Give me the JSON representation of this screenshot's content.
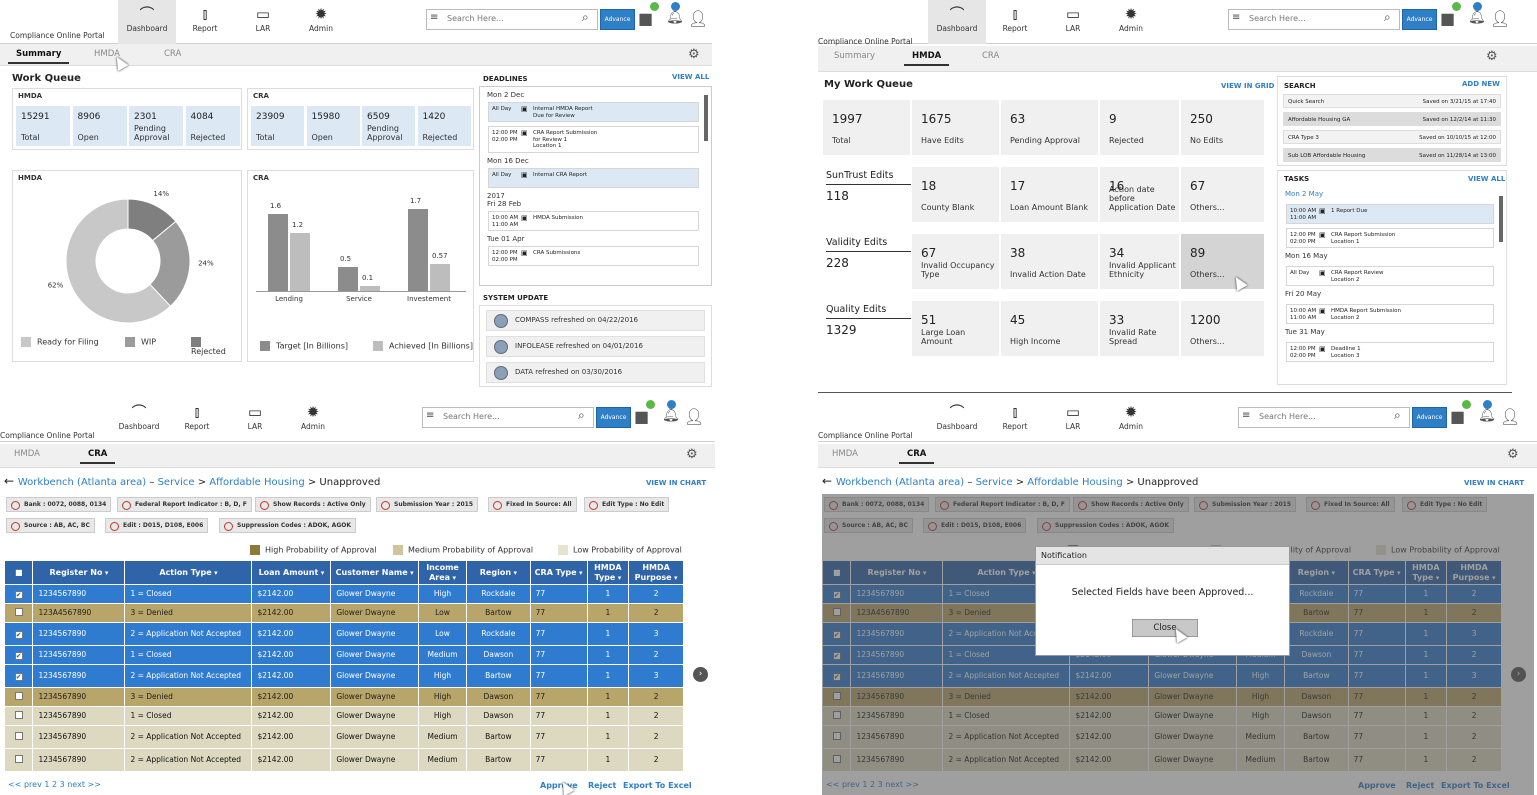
{
  "app": {
    "brand": "Compliance Online Portal",
    "nav": [
      "Dashboard",
      "Report",
      "LAR",
      "Admin"
    ],
    "search_placeholder": "Search Here...",
    "advance": "Advance"
  },
  "q1": {
    "tabs": [
      "Summary",
      "HMDA",
      "CRA"
    ],
    "work_queue": "Work Queue",
    "deadlines": "DEADLINES",
    "view_all": "VIEW ALL",
    "hmda": {
      "title": "HMDA",
      "tiles": [
        [
          "15291",
          "Total"
        ],
        [
          "8906",
          "Open"
        ],
        [
          "2301",
          "Pending Approval"
        ],
        [
          "4084",
          "Rejected"
        ]
      ]
    },
    "cra": {
      "title": "CRA",
      "tiles": [
        [
          "23909",
          "Total"
        ],
        [
          "15980",
          "Open"
        ],
        [
          "6509",
          "Pending Approval"
        ],
        [
          "1420",
          "Rejected"
        ]
      ]
    },
    "deadline_items": [
      {
        "date": "Mon 2 Dec"
      },
      {
        "time": "All Day",
        "text": "Internal HMDA Report\nDue for Review",
        "hl": true
      },
      {
        "time": "12:00 PM\n02:00 PM",
        "text": "CRA Report Submission\nfor Review 1\nLocation 1"
      },
      {
        "date": "Mon 16 Dec"
      },
      {
        "time": "All Day",
        "text": "Internal CRA Report",
        "hl": true
      },
      {
        "date": "2017\nFri 28 Feb"
      },
      {
        "time": "10:00 AM\n11:00 AM",
        "text": "HMDA Submission"
      },
      {
        "date": "Tue 01 Apr"
      },
      {
        "time": "12:00 PM\n02:00 PM",
        "text": "CRA Submissions"
      }
    ],
    "system_update": "SYSTEM UPDATE",
    "updates": [
      "COMPASS refreshed on 04/22/2016",
      "INFOLEASE refreshed on 04/01/2016",
      "DATA refreshed on 03/30/2016"
    ],
    "donut_title": "HMDA",
    "donut_legend": [
      "Ready for Filing",
      "WIP",
      "Rejected"
    ],
    "bar_title": "CRA",
    "bar_legend": [
      "Target [In Billions]",
      "Achieved [In Billions]"
    ]
  },
  "chart_data": [
    {
      "type": "pie",
      "title": "HMDA",
      "categories": [
        "Ready for Filing",
        "WIP",
        "Rejected"
      ],
      "values": [
        62,
        24,
        14
      ],
      "colors": [
        "#c8c8c8",
        "#9b9b9b",
        "#7f7f7f"
      ],
      "labels": [
        "62%",
        "24%",
        "14%"
      ]
    },
    {
      "type": "bar",
      "title": "CRA",
      "categories": [
        "Lending",
        "Service",
        "Investement"
      ],
      "series": [
        {
          "name": "Target [In Billions]",
          "values": [
            1.6,
            0.5,
            1.7
          ],
          "color": "#8c8c8c"
        },
        {
          "name": "Achieved [In Billions]",
          "values": [
            1.2,
            0.1,
            0.57
          ],
          "color": "#bdbdbd"
        }
      ],
      "ylim": [
        0,
        2
      ]
    }
  ],
  "q2": {
    "tabs": [
      "Summary",
      "HMDA",
      "CRA"
    ],
    "title": "My Work Queue",
    "view_grid": "VIEW IN GRID",
    "row1": [
      [
        "1997",
        "Total"
      ],
      [
        "1675",
        "Have Edits"
      ],
      [
        "63",
        "Pending Approval"
      ],
      [
        "9",
        "Rejected"
      ],
      [
        "250",
        "No Edits"
      ]
    ],
    "groups": [
      {
        "name": "SunTrust  Edits",
        "count": "118",
        "tiles": [
          [
            "18",
            "County Blank"
          ],
          [
            "17",
            "Loan Amount Blank"
          ],
          [
            "16",
            "Action date before Application Date"
          ],
          [
            "67",
            "Others..."
          ]
        ]
      },
      {
        "name": "Validity Edits",
        "count": "228",
        "tiles": [
          [
            "67",
            "Invalid Occupancy Type"
          ],
          [
            "38",
            "Invalid Action Date"
          ],
          [
            "34",
            "Invalid Applicant Ethnicity"
          ],
          [
            "89",
            "Others..."
          ]
        ]
      },
      {
        "name": "Quality Edits",
        "count": "1329",
        "tiles": [
          [
            "51",
            "Large Loan Amount"
          ],
          [
            "45",
            "High Income"
          ],
          [
            "33",
            "Invalid Rate Spread"
          ],
          [
            "1200",
            "Others..."
          ]
        ]
      }
    ],
    "search": "SEARCH",
    "add_new": "ADD NEW",
    "searches": [
      [
        "Quick Search",
        "Saved on 3/21/15 at 17:40"
      ],
      [
        "Affordable Housing GA",
        "Saved on 12/2/14 at 11:30"
      ],
      [
        "CRA Type 3",
        "Saved on 10/10/15 at 12:00"
      ],
      [
        "Sub LOB Affordable Housing",
        "Saved on 11/28/14 at 13:00"
      ]
    ],
    "tasks": "TASKS",
    "view_all": "VIEW ALL",
    "task_items": [
      {
        "date": "Mon 2 May"
      },
      {
        "time": "10:00 AM\n11:00 AM",
        "text": "1 Report Due",
        "hl": true
      },
      {
        "time": "12:00 PM\n02:00 PM",
        "text": "CRA Report Submission\nLocation 1"
      },
      {
        "date": "Mon 16 May"
      },
      {
        "time": "All Day",
        "text": "CRA Report Review\nLocation 2"
      },
      {
        "date": "Fri 20 May"
      },
      {
        "time": "10:00 AM\n11:00 AM",
        "text": "HMDA Report Submission\nLocation 2"
      },
      {
        "date": "Tue 31 May"
      },
      {
        "time": "12:00 PM\n02:00 PM",
        "text": "Deadline 1\nLocation 3"
      }
    ]
  },
  "wb": {
    "tabs": [
      "HMDA",
      "CRA"
    ],
    "crumb": {
      "a": "Workbench (Atlanta area)",
      "b": "Service",
      "c": "Affordable Housing",
      "d": "Unapproved"
    },
    "view_chart": "VIEW IN CHART",
    "chips1": [
      "Bank : 0072, 0088, 0134",
      "Federal Report Indicator : B, D, F",
      "Show Records : Active Only",
      "Submission Year : 2015",
      "Fixed In Source: All",
      "Edit Type : No Edit"
    ],
    "chips2": [
      "Source : AB, AC, BC",
      "Edit : D015, D108, E006",
      "Suppression Codes : ADOK, AGOK"
    ],
    "legend": [
      "High Probability of Approval",
      "Medium Probability of Approval",
      "Low Probability of Approval"
    ],
    "cols": [
      "Register No",
      "Action Type",
      "Loan Amount",
      "Customer Name",
      "Income Area",
      "Region",
      "CRA Type",
      "HMDA Type",
      "HMDA Purpose"
    ],
    "rows": [
      [
        "1234567890",
        "1 = Closed",
        "$2142.00",
        "Glower Dwayne",
        "High",
        "Rockdale",
        "77",
        "1",
        "2",
        "blue",
        true
      ],
      [
        "123A4567890",
        "3 = Denied",
        "$2142.00",
        "Glower Dwayne",
        "Low",
        "Bartow",
        "77",
        "1",
        "2",
        "olive",
        false
      ],
      [
        "1234567890",
        "2 = Application Not Accepted",
        "$2142.00",
        "Glower Dwayne",
        "Low",
        "Rockdale",
        "77",
        "1",
        "3",
        "blue",
        true
      ],
      [
        "1234567890",
        "1 = Closed",
        "$2142.00",
        "Glower Dwayne",
        "Medium",
        "Dawson",
        "77",
        "1",
        "2",
        "blue",
        true
      ],
      [
        "1234567890",
        "2 = Application Not Accepted",
        "$2142.00",
        "Glower Dwayne",
        "High",
        "Bartow",
        "77",
        "1",
        "3",
        "blue",
        true
      ],
      [
        "1234567890",
        "3 = Denied",
        "$2142.00",
        "Glower Dwayne",
        "High",
        "Dawson",
        "77",
        "1",
        "2",
        "olive",
        false
      ],
      [
        "1234567890",
        "1 = Closed",
        "$2142.00",
        "Glower Dwayne",
        "High",
        "Dawson",
        "77",
        "1",
        "2",
        "beige",
        false
      ],
      [
        "1234567890",
        "2 = Application Not Accepted",
        "$2142.00",
        "Glower Dwayne",
        "Medium",
        "Bartow",
        "77",
        "1",
        "2",
        "beige",
        false
      ],
      [
        "1234567890",
        "2 = Application Not Accepted",
        "$2142.00",
        "Glower Dwayne",
        "Medium",
        "Bartow",
        "77",
        "1",
        "2",
        "beige",
        false
      ]
    ],
    "pager": "<< prev  1  2  3  next >>",
    "approve": "Approve",
    "reject": "Reject",
    "export": "Export To Excel",
    "notification": {
      "title": "Notification",
      "message": "Selected Fields have been Approved...",
      "close": "Close"
    }
  }
}
